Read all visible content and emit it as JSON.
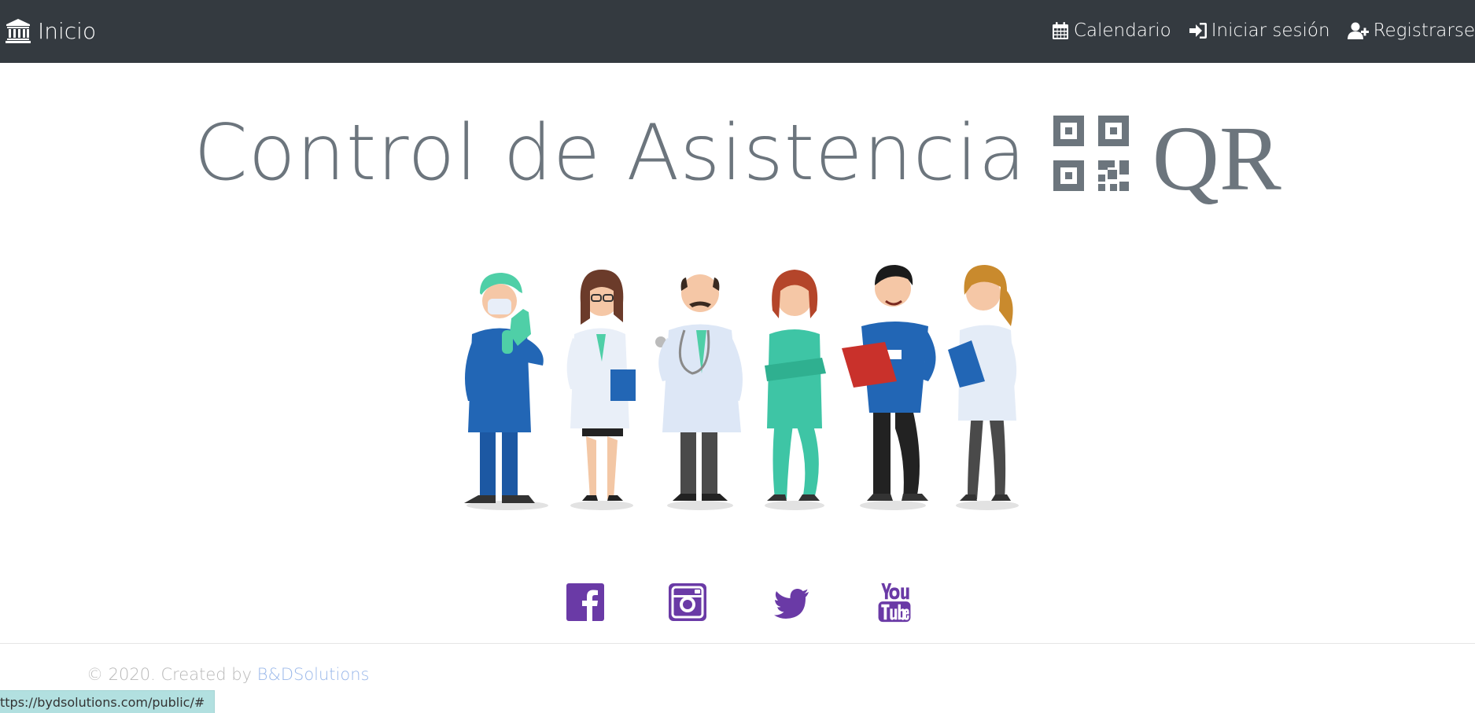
{
  "navbar": {
    "brand": {
      "label": "Inicio",
      "icon": "university-icon"
    },
    "items": [
      {
        "label": "Calendario",
        "icon": "calendar-icon"
      },
      {
        "label": "Iniciar sesión",
        "icon": "sign-in-icon"
      },
      {
        "label": "Registrarse",
        "icon": "user-plus-icon"
      }
    ]
  },
  "hero": {
    "title": "Control de Asistencia",
    "qr_label": "QR",
    "icon": "qrcode-icon"
  },
  "illustration": {
    "icon": "medical-staff-illustration"
  },
  "social": [
    {
      "name": "facebook-icon"
    },
    {
      "name": "instagram-icon"
    },
    {
      "name": "twitter-icon"
    },
    {
      "name": "youtube-icon"
    }
  ],
  "footer": {
    "copyright": "© 2020. Created by ",
    "company": "B&DSolutions"
  },
  "status": {
    "url": "ttps://bydsolutions.com/public/#"
  },
  "colors": {
    "navbar_bg": "#343a40",
    "text_gray": "#6c757d",
    "social_purple": "#6a3aa6",
    "link_blue": "#9ab8ea"
  }
}
